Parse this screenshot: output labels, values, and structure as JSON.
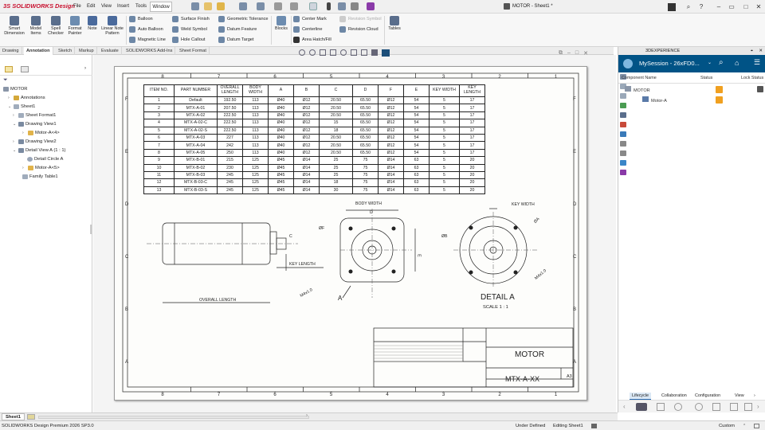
{
  "app": {
    "logo_ds": "3S",
    "logo_text": "SOLIDWORKS Design",
    "document_title": "MOTOR - Sheet1 *"
  },
  "menu": [
    "File",
    "Edit",
    "View",
    "Insert",
    "Tools",
    "Window"
  ],
  "ribbon": {
    "big_buttons": [
      "Smart Dimension",
      "Model Items",
      "Spell Checker",
      "Format Painter",
      "Note",
      "Linear Note Pattern"
    ],
    "col1": [
      "Balloon",
      "Auto Balloon",
      "Magnetic Line"
    ],
    "col2": [
      "Surface Finish",
      "Weld Symbol",
      "Hole Callout"
    ],
    "col3": [
      "Geometric Tolerance",
      "Datum Feature",
      "Datum Target"
    ],
    "blocks": "Blocks",
    "col4": [
      "Center Mark",
      "Centerline",
      "Area Hatch/Fill"
    ],
    "col5": [
      "Revision Symbol",
      "Revision Cloud"
    ],
    "tables": "Tables"
  },
  "tabs": [
    "Drawing",
    "Annotation",
    "Sketch",
    "Markup",
    "Evaluate",
    "SOLIDWORKS Add-Ins",
    "Sheet Format"
  ],
  "tree": [
    {
      "label": "MOTOR"
    },
    {
      "label": "Annotations"
    },
    {
      "label": "Sheet1"
    },
    {
      "label": "Sheet Format1"
    },
    {
      "label": "Drawing View1"
    },
    {
      "label": "Motor-A<4>"
    },
    {
      "label": "Drawing View2"
    },
    {
      "label": "Detail View A (1 : 1)"
    },
    {
      "label": "Detail Circle A"
    },
    {
      "label": "Motor-A<5>"
    },
    {
      "label": "Family Table1"
    }
  ],
  "zones_top": [
    "8",
    "7",
    "6",
    "5",
    "4",
    "3",
    "2",
    "1"
  ],
  "zones_side": [
    "F",
    "E",
    "D",
    "C",
    "B",
    "A"
  ],
  "table": {
    "headers": [
      "ITEM NO.",
      "PART NUMBER",
      "OVERALL LENGTH",
      "BODY WIDTH",
      "A",
      "B",
      "C",
      "D",
      "F",
      "E",
      "KEY WIDTH",
      "KEY LENGTH"
    ],
    "rows": [
      [
        "1",
        "Default",
        "192.50",
        "113",
        "Ø40",
        "Ø12",
        "20.50",
        "65.50",
        "Ø12",
        "54",
        "5",
        "17"
      ],
      [
        "2",
        "MTX-A-01",
        "207.50",
        "113",
        "Ø40",
        "Ø12",
        "20.50",
        "65.50",
        "Ø12",
        "54",
        "5",
        "17"
      ],
      [
        "3",
        "MTX-A-02",
        "222.50",
        "113",
        "Ø40",
        "Ø12",
        "20.50",
        "65.50",
        "Ø12",
        "54",
        "5",
        "17"
      ],
      [
        "4",
        "MTX-A-02-C",
        "222.50",
        "113",
        "Ø40",
        "Ø12",
        "15",
        "65.50",
        "Ø12",
        "54",
        "5",
        "17"
      ],
      [
        "5",
        "MTX-A-02-S",
        "222.50",
        "113",
        "Ø40",
        "Ø12",
        "18",
        "65.50",
        "Ø12",
        "54",
        "5",
        "17"
      ],
      [
        "6",
        "MTX-A-03",
        "227",
        "113",
        "Ø40",
        "Ø12",
        "20.50",
        "65.50",
        "Ø12",
        "54",
        "5",
        "17"
      ],
      [
        "7",
        "MTX-A-04",
        "242",
        "113",
        "Ø40",
        "Ø12",
        "20.50",
        "65.50",
        "Ø12",
        "54",
        "5",
        "17"
      ],
      [
        "8",
        "MTX-A-05",
        "250",
        "113",
        "Ø40",
        "Ø12",
        "20.50",
        "65.50",
        "Ø12",
        "54",
        "5",
        "17"
      ],
      [
        "9",
        "MTX-B-01",
        "215",
        "125",
        "Ø45",
        "Ø14",
        "25",
        "75",
        "Ø14",
        "63",
        "5",
        "20"
      ],
      [
        "10",
        "MTX-B-02",
        "230",
        "125",
        "Ø45",
        "Ø14",
        "25",
        "75",
        "Ø14",
        "63",
        "5",
        "20"
      ],
      [
        "11",
        "MTX-B-03",
        "245",
        "125",
        "Ø45",
        "Ø14",
        "25",
        "75",
        "Ø14",
        "63",
        "5",
        "20"
      ],
      [
        "12",
        "MTX-B-03-C",
        "245",
        "125",
        "Ø45",
        "Ø14",
        "18",
        "75",
        "Ø14",
        "63",
        "5",
        "20"
      ],
      [
        "13",
        "MTX-B-03-S",
        "245",
        "125",
        "Ø45",
        "Ø14",
        "30",
        "75",
        "Ø14",
        "63",
        "5",
        "20"
      ]
    ]
  },
  "views": {
    "overall_length": "OVERALL LENGTH",
    "key_length": "KEY LENGTH",
    "c": "C",
    "body_width": "BODY WIDTH",
    "d": "D",
    "f": "ØF",
    "m4": "M4x1.0",
    "e": "E",
    "a": "A",
    "key_width": "KEY WIDTH",
    "oa": "ØA",
    "ob": "ØB",
    "detail": "DETAIL A",
    "scale": "SCALE 1 : 1"
  },
  "titleblock": {
    "title": "MOTOR",
    "dwg": "MTX-A-XX",
    "size": "A3"
  },
  "right_panel": {
    "header": "3DEXPERIENCE",
    "session": "MySession - 26xFD0...",
    "columns": [
      "Component Name",
      "Status",
      "Lock Status"
    ],
    "rows": [
      "MOTOR",
      "Motor-A"
    ],
    "tabs": [
      "Lifecycle",
      "Collaboration",
      "Configuration",
      "View"
    ]
  },
  "sheet_tab": "Sheet1",
  "status": {
    "product": "SOLIDWORKS Design Premium 2026 SP3.0",
    "state": "Under Defined",
    "editing": "Editing Sheet1",
    "units": "Custom"
  }
}
